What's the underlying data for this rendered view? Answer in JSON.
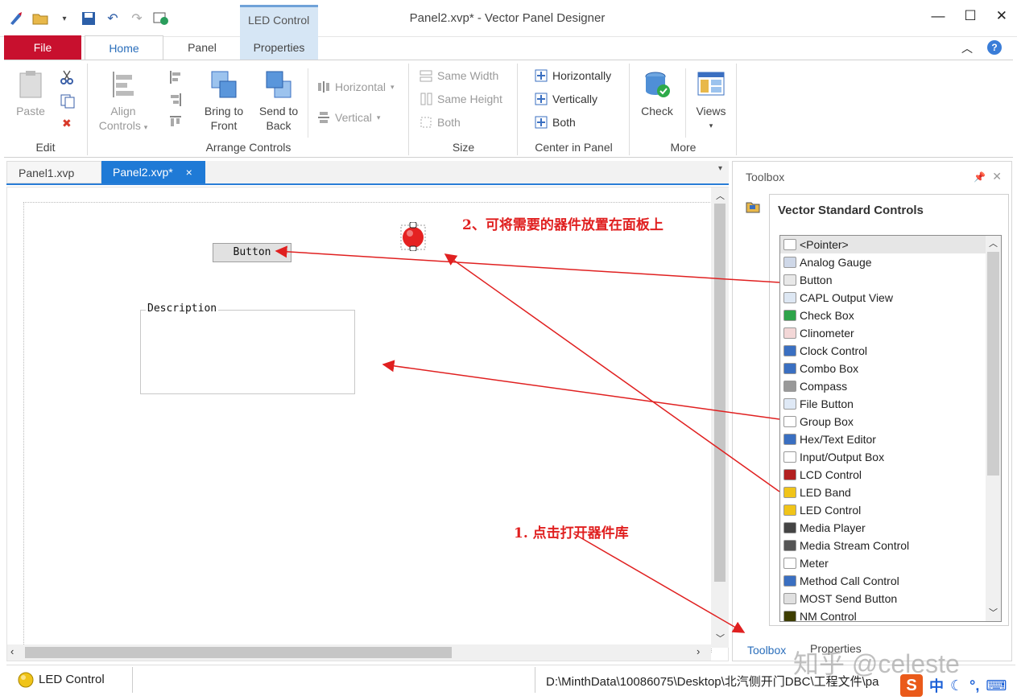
{
  "app": {
    "window_title": "Panel2.xvp* - Vector Panel Designer",
    "context_tab": "LED Control"
  },
  "ribbon": {
    "tabs": {
      "file": "File",
      "home": "Home",
      "panel": "Panel",
      "properties": "Properties"
    },
    "groups": {
      "edit": {
        "label": "Edit",
        "paste": "Paste"
      },
      "arrange": {
        "label": "Arrange Controls",
        "align_1": "Align",
        "align_2": "Controls",
        "bring_1": "Bring to",
        "bring_2": "Front",
        "send_1": "Send to",
        "send_2": "Back",
        "horizontal": "Horizontal",
        "vertical": "Vertical"
      },
      "size": {
        "label": "Size",
        "same_width": "Same Width",
        "same_height": "Same Height",
        "both": "Both"
      },
      "center": {
        "label": "Center in Panel",
        "horizontally": "Horizontally",
        "vertically": "Vertically",
        "both": "Both"
      },
      "more": {
        "label": "More",
        "check": "Check",
        "views": "Views"
      }
    }
  },
  "documents": {
    "tabs": [
      {
        "label": "Panel1.xvp",
        "active": false
      },
      {
        "label": "Panel2.xvp*",
        "active": true
      }
    ],
    "close_glyph": "×"
  },
  "canvas": {
    "button_control": "Button",
    "group_box_label": "Description"
  },
  "toolbox": {
    "title": "Toolbox",
    "category": "Vector Standard Controls",
    "items": [
      "<Pointer>",
      "Analog Gauge",
      "Button",
      "CAPL Output View",
      "Check Box",
      "Clinometer",
      "Clock Control",
      "Combo Box",
      "Compass",
      "File Button",
      "Group Box",
      "Hex/Text Editor",
      "Input/Output Box",
      "LCD Control",
      "LED Band",
      "LED Control",
      "Media Player",
      "Media Stream Control",
      "Meter",
      "Method Call Control",
      "MOST Send Button",
      "NM Control"
    ],
    "bottom_tabs": [
      "Toolbox",
      "Properties"
    ]
  },
  "statusbar": {
    "selected_control": "LED Control",
    "path": "D:\\MinthData\\10086075\\Desktop\\北汽侧开门DBC\\工程文件\\pa"
  },
  "annotations": {
    "step2": "2、可将需要的器件放置在面板上",
    "step1": "1. 点击打开器件库",
    "color": "#e02020"
  },
  "watermark": "知乎 @celeste",
  "ime": {
    "s": "S",
    "lang": "中"
  },
  "colors": {
    "accent": "#1f7ad6",
    "file_tab": "#c8102e",
    "context": "#d6e6f5",
    "led": "#e52222"
  }
}
